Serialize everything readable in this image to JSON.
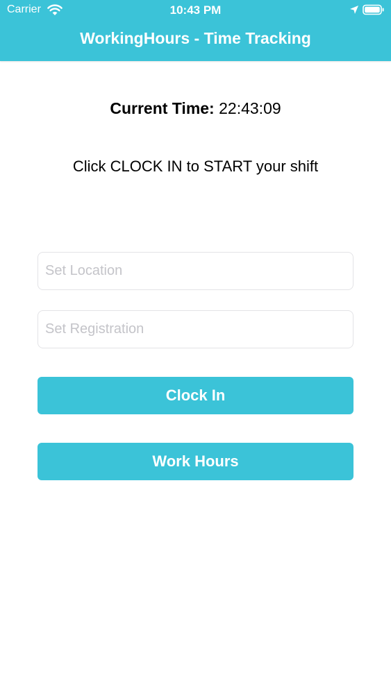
{
  "status_bar": {
    "carrier": "Carrier",
    "time": "10:43 PM",
    "icons": [
      "wifi-icon",
      "location-arrow-icon",
      "battery-icon"
    ]
  },
  "nav": {
    "title": "WorkingHours - Time Tracking"
  },
  "main": {
    "current_time_label": "Current Time:",
    "current_time_value": "22:43:09",
    "instruction": "Click CLOCK IN to START your shift",
    "location_field": {
      "value": "",
      "placeholder": "Set Location"
    },
    "registration_field": {
      "value": "",
      "placeholder": "Set Registration"
    },
    "clock_in_label": "Clock In",
    "work_hours_label": "Work Hours"
  },
  "colors": {
    "accent": "#3bc3d8",
    "text": "#000000",
    "placeholder": "#c4c4c9",
    "field_border": "#e3e3e6"
  }
}
